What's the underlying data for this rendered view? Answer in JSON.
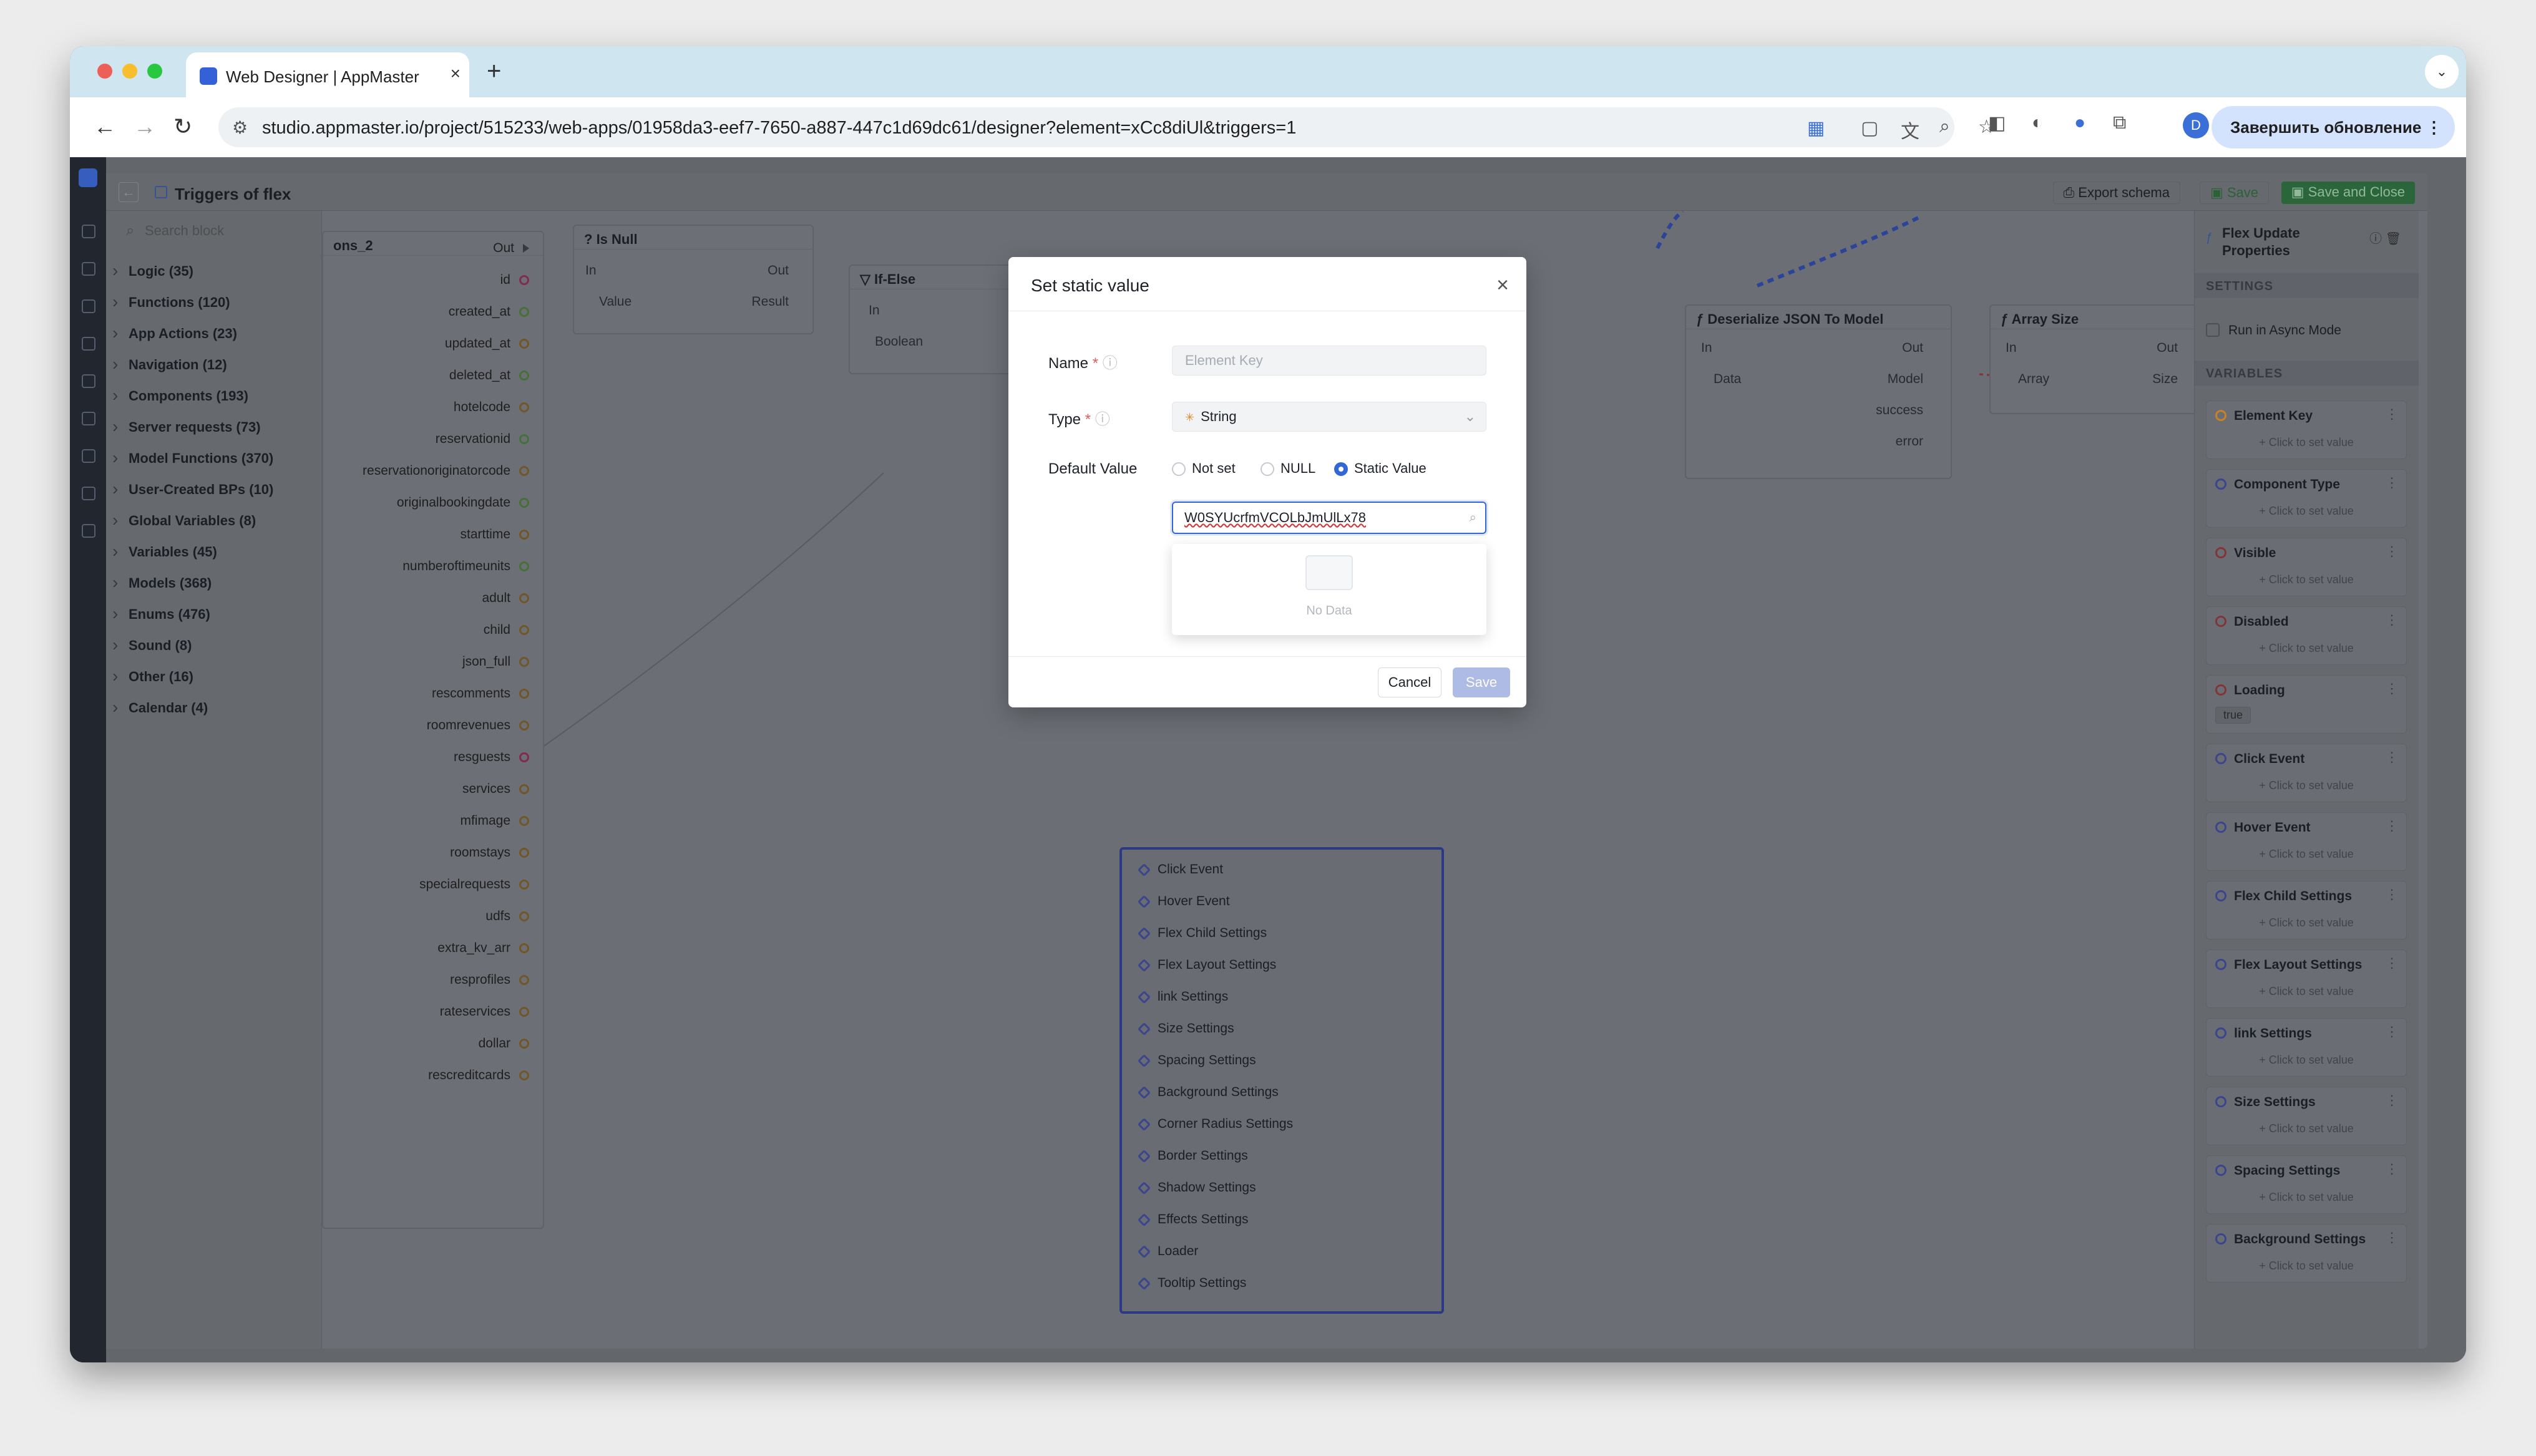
{
  "browser": {
    "tab_title": "Web Designer | AppMaster",
    "url": "studio.appmaster.io/project/515233/web-apps/01958da3-eef7-7650-a887-447c1d69dc61/designer?element=xCc8diUl&triggers=1",
    "update_button": "Завершить обновление",
    "profile_initial": "D"
  },
  "header": {
    "title": "Triggers of flex",
    "export_label": "Export schema",
    "save_label": "Save",
    "save_close_label": "Save and Close"
  },
  "blocks": {
    "search_placeholder": "Search block",
    "items": [
      "Logic (35)",
      "Functions (120)",
      "App Actions (23)",
      "Navigation (12)",
      "Components (193)",
      "Server requests (73)",
      "Model Functions (370)",
      "User-Created BPs (10)",
      "Global Variables (8)",
      "Variables (45)",
      "Models (368)",
      "Enums (476)",
      "Sound (8)",
      "Other (16)",
      "Calendar (4)"
    ]
  },
  "canvas": {
    "node_partial_title": "ons_2",
    "fields": [
      "Out",
      "id",
      "created_at",
      "updated_at",
      "deleted_at",
      "hotelcode",
      "reservationid",
      "reservationoriginatorcode",
      "originalbookingdate",
      "starttime",
      "numberoftimeunits",
      "adult",
      "child",
      "json_full",
      "rescomments",
      "roomrevenues",
      "resguests",
      "services",
      "mfimage",
      "roomstays",
      "specialrequests",
      "udfs",
      "extra_kv_arr",
      "resprofiles",
      "rateservices",
      "dollar",
      "rescreditcards"
    ],
    "nodes": {
      "is_null": {
        "title": "Is Null",
        "in": "In",
        "out": "Out",
        "value": "Value",
        "result": "Result"
      },
      "if_else": {
        "title": "If-Else",
        "in": "In",
        "boolean": "Boolean"
      },
      "deserialize": {
        "title": "Deserialize JSON To Model",
        "in": "In",
        "out": "Out",
        "data": "Data",
        "model": "Model",
        "success": "success",
        "error": "error"
      },
      "array_size": {
        "title": "Array Size",
        "in": "In",
        "out": "Out",
        "array": "Array",
        "size": "Size"
      }
    },
    "event_items": [
      "Click Event",
      "Hover Event",
      "Flex Child Settings",
      "Flex Layout Settings",
      "link Settings",
      "Size Settings",
      "Spacing Settings",
      "Background Settings",
      "Corner Radius Settings",
      "Border Settings",
      "Shadow Settings",
      "Effects Settings",
      "Loader",
      "Tooltip Settings"
    ]
  },
  "properties": {
    "title": "Flex Update Properties",
    "settings_label": "SETTINGS",
    "async_label": "Run in Async Mode",
    "variables_label": "VARIABLES",
    "hint": "+ Click to set value",
    "variables": [
      {
        "name": "Element Key",
        "value": ""
      },
      {
        "name": "Component Type",
        "value": ""
      },
      {
        "name": "Visible",
        "value": ""
      },
      {
        "name": "Disabled",
        "value": ""
      },
      {
        "name": "Loading",
        "value": "true"
      },
      {
        "name": "Click Event",
        "value": ""
      },
      {
        "name": "Hover Event",
        "value": ""
      },
      {
        "name": "Flex Child Settings",
        "value": ""
      },
      {
        "name": "Flex Layout Settings",
        "value": ""
      },
      {
        "name": "link Settings",
        "value": ""
      },
      {
        "name": "Size Settings",
        "value": ""
      },
      {
        "name": "Spacing Settings",
        "value": ""
      },
      {
        "name": "Background Settings",
        "value": ""
      }
    ]
  },
  "modal": {
    "title": "Set static value",
    "name_label": "Name",
    "name_placeholder": "Element Key",
    "type_label": "Type",
    "type_value": "String",
    "default_label": "Default Value",
    "options": [
      "Not set",
      "NULL",
      "Static Value"
    ],
    "selected": "Static Value",
    "input_value": "W0SYUcrfmVCOLbJmUlLx78",
    "no_data": "No Data",
    "cancel": "Cancel",
    "save": "Save"
  },
  "colors": {
    "accent": "#3467d6",
    "save_green": "#2e8a44",
    "warning": "#d98c2b"
  }
}
